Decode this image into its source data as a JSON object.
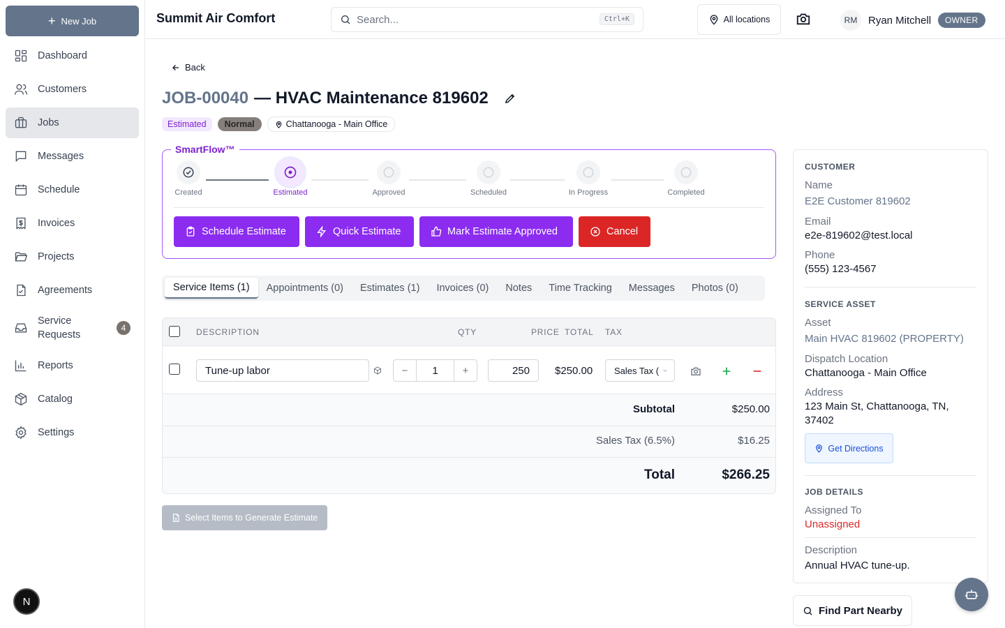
{
  "sidebar": {
    "new_job": "New Job",
    "items": [
      {
        "label": "Dashboard"
      },
      {
        "label": "Customers"
      },
      {
        "label": "Jobs"
      },
      {
        "label": "Messages"
      },
      {
        "label": "Schedule"
      },
      {
        "label": "Invoices"
      },
      {
        "label": "Projects"
      },
      {
        "label": "Agreements"
      },
      {
        "label": "Service Requests",
        "badge": "4"
      },
      {
        "label": "Reports"
      },
      {
        "label": "Catalog"
      },
      {
        "label": "Settings"
      }
    ],
    "avatar": "N"
  },
  "header": {
    "company": "Summit Air Comfort",
    "search_placeholder": "Search...",
    "shortcut": "Ctrl+K",
    "locations": "All locations",
    "user_initials": "RM",
    "user_name": "Ryan Mitchell",
    "role": "OWNER"
  },
  "job": {
    "back": "Back",
    "id": "JOB-00040",
    "title": "— HVAC Maintenance 819602",
    "status": "Estimated",
    "priority": "Normal",
    "location": "Chattanooga - Main Office"
  },
  "smartflow": {
    "label": "SmartFlow™",
    "steps": [
      {
        "label": "Created",
        "state": "done"
      },
      {
        "label": "Estimated",
        "state": "current"
      },
      {
        "label": "Approved",
        "state": "pending"
      },
      {
        "label": "Scheduled",
        "state": "pending"
      },
      {
        "label": "In Progress",
        "state": "pending"
      },
      {
        "label": "Completed",
        "state": "pending"
      }
    ],
    "actions": [
      "Schedule Estimate",
      "Quick Estimate",
      "Mark Estimate Approved",
      "Cancel"
    ]
  },
  "tabs": [
    "Service Items (1)",
    "Appointments (0)",
    "Estimates (1)",
    "Invoices (0)",
    "Notes",
    "Time Tracking",
    "Messages",
    "Photos (0)"
  ],
  "items_table": {
    "columns": {
      "description": "DESCRIPTION",
      "qty": "QTY",
      "price": "PRICE",
      "total": "TOTAL",
      "tax": "TAX"
    },
    "rows": [
      {
        "description": "Tune-up labor",
        "qty": "1",
        "price": "250",
        "total": "$250.00",
        "tax": "Sales Tax ("
      }
    ],
    "stepper_minus": "−",
    "stepper_plus": "+",
    "subtotal_label": "Subtotal",
    "subtotal": "$250.00",
    "tax_label": "Sales Tax (6.5%)",
    "tax_value": "$16.25",
    "total_label": "Total",
    "total": "$266.25"
  },
  "generate_btn": "Select Items to Generate Estimate",
  "customer_panel": {
    "customer_title": "CUSTOMER",
    "name_label": "Name",
    "name": "E2E Customer 819602",
    "email_label": "Email",
    "email": "e2e-819602@test.local",
    "phone_label": "Phone",
    "phone": "(555) 123-4567",
    "asset_title": "SERVICE ASSET",
    "asset_label": "Asset",
    "asset": "Main HVAC 819602 (PROPERTY)",
    "dispatch_label": "Dispatch Location",
    "dispatch": "Chattanooga - Main Office",
    "address_label": "Address",
    "address_line1": "123 Main St, Chattanooga, TN,",
    "address_line2": "37402",
    "directions": "Get Directions",
    "details_title": "JOB DETAILS",
    "assigned_label": "Assigned To",
    "assigned": "Unassigned",
    "description_label": "Description",
    "description": "Annual HVAC tune-up."
  },
  "find_part": "Find Part Nearby"
}
